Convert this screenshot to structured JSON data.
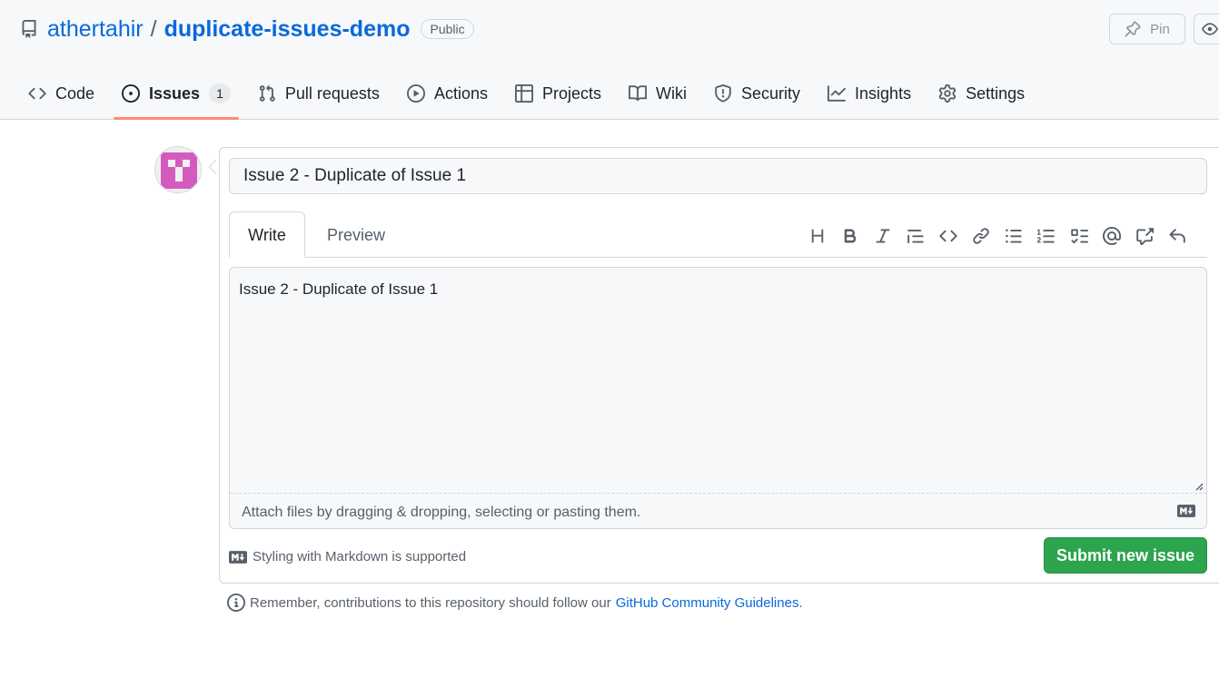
{
  "repo": {
    "owner": "athertahir",
    "separator": "/",
    "name": "duplicate-issues-demo",
    "visibility": "Public"
  },
  "header_actions": {
    "pin_label": "Pin"
  },
  "tabs": [
    {
      "label": "Code",
      "icon": "code-icon"
    },
    {
      "label": "Issues",
      "icon": "issue-opened-icon",
      "count": "1",
      "active": true
    },
    {
      "label": "Pull requests",
      "icon": "git-pull-request-icon"
    },
    {
      "label": "Actions",
      "icon": "play-icon"
    },
    {
      "label": "Projects",
      "icon": "table-icon"
    },
    {
      "label": "Wiki",
      "icon": "book-icon"
    },
    {
      "label": "Security",
      "icon": "shield-icon"
    },
    {
      "label": "Insights",
      "icon": "graph-icon"
    },
    {
      "label": "Settings",
      "icon": "gear-icon"
    }
  ],
  "issue_form": {
    "title_value": "Issue 2 - Duplicate of Issue 1",
    "write_tab": "Write",
    "preview_tab": "Preview",
    "body_value": "Issue 2 - Duplicate of Issue 1",
    "attach_hint": "Attach files by dragging & dropping, selecting or pasting them.",
    "markdown_note": "Styling with Markdown is supported",
    "submit_label": "Submit new issue",
    "toolbar": [
      "heading",
      "bold",
      "italic",
      "quote",
      "code",
      "link",
      "unordered-list",
      "ordered-list",
      "task-list",
      "mention",
      "cross-reference",
      "reply"
    ]
  },
  "footer_note": {
    "text": "Remember, contributions to this repository should follow our",
    "link_text": "GitHub Community Guidelines",
    "suffix": "."
  },
  "colors": {
    "link": "#0969da",
    "submit_green": "#2da44e",
    "active_tab_underline": "#fd8c73",
    "avatar_pink": "#d45bbd"
  }
}
